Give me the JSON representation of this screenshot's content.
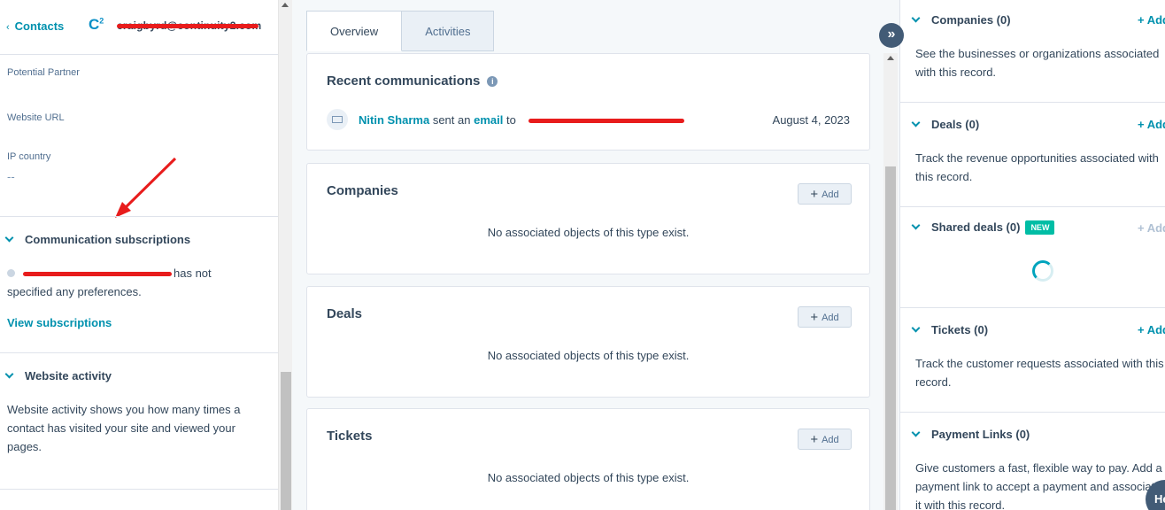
{
  "left": {
    "back_label": "Contacts",
    "logo_text": "C",
    "logo_sup": "2",
    "properties": [
      {
        "label": "Potential Partner",
        "value": ""
      },
      {
        "label": "Website URL",
        "value": ""
      },
      {
        "label": "IP country",
        "value": "--"
      }
    ],
    "comm_subs": {
      "title": "Communication subscriptions",
      "text_suffix": "has not",
      "text_line2": "specified any preferences.",
      "link": "View subscriptions"
    },
    "website_activity": {
      "title": "Website activity",
      "text": "Website activity shows you how many times a contact has visited your site and viewed your pages."
    }
  },
  "middle": {
    "tabs": [
      {
        "label": "Overview",
        "active": true
      },
      {
        "label": "Activities",
        "active": false
      }
    ],
    "recent": {
      "title": "Recent communications",
      "sender": "Nitin Sharma",
      "verb": "sent an",
      "channel": "email",
      "to": "to",
      "date": "August 4, 2023"
    },
    "cards": [
      {
        "title": "Companies",
        "add_label": "Add",
        "empty": "No associated objects of this type exist."
      },
      {
        "title": "Deals",
        "add_label": "Add",
        "empty": "No associated objects of this type exist."
      },
      {
        "title": "Tickets",
        "add_label": "Add",
        "empty": "No associated objects of this type exist."
      }
    ],
    "expand_glyph": "»"
  },
  "right": {
    "sections": [
      {
        "title": "Companies (0)",
        "add": "+ Add",
        "text": "See the businesses or organizations associated with this record."
      },
      {
        "title": "Deals (0)",
        "add": "+ Add",
        "text": "Track the revenue opportunities associated with this record."
      },
      {
        "title": "Shared deals (0)",
        "badge": "NEW",
        "add": "+ Add",
        "text": ""
      },
      {
        "title": "Tickets (0)",
        "add": "+ Add",
        "text": "Track the customer requests associated with this record."
      },
      {
        "title": "Payment Links (0)",
        "add": "",
        "text": "Give customers a fast, flexible way to pay. Add a payment link to accept a payment and associate it with this record."
      }
    ],
    "help_label": "He"
  },
  "colors": {
    "accent": "#0091ae",
    "text": "#33475b",
    "redaction": "#e81c1c",
    "new_badge": "#00bda5"
  }
}
